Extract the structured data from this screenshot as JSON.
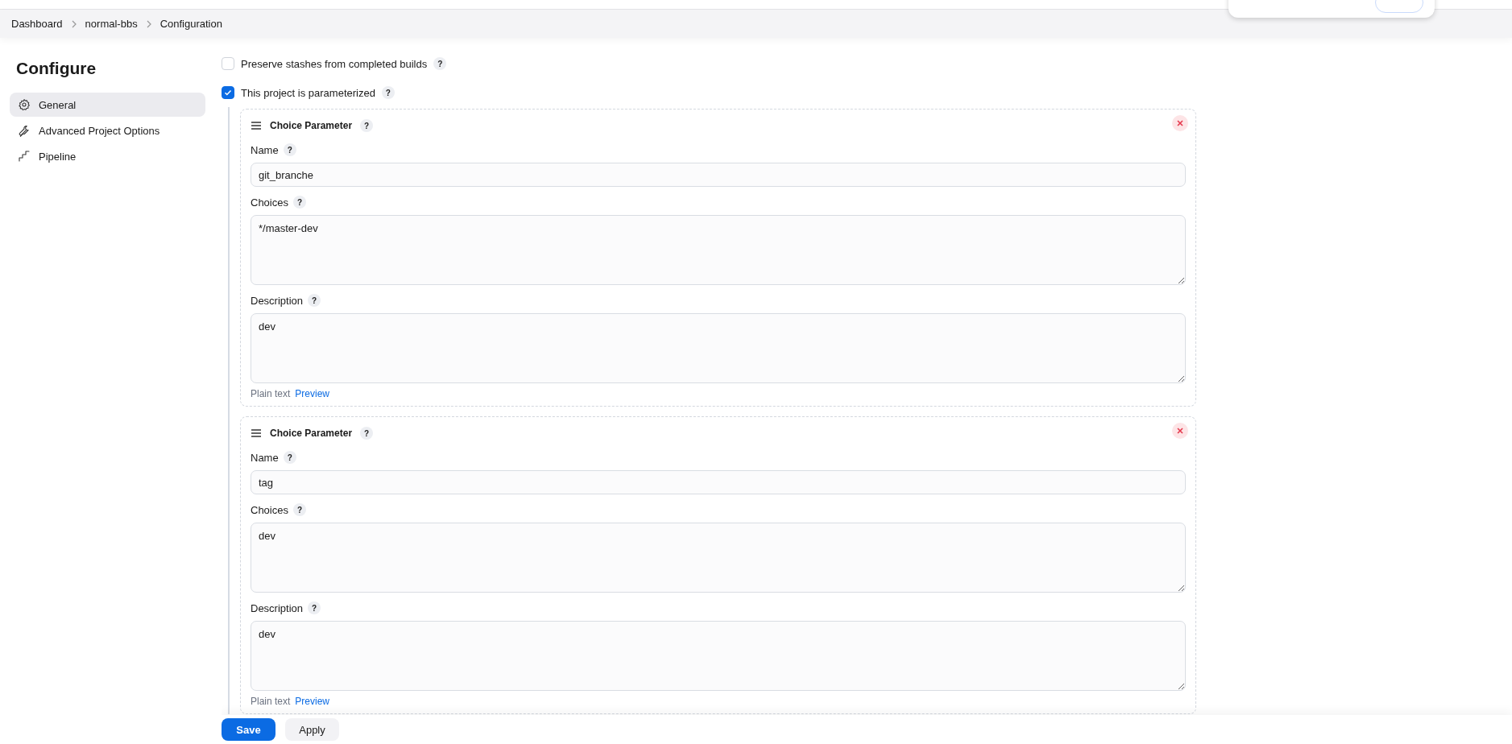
{
  "breadcrumbs": [
    "Dashboard",
    "normal-bbs",
    "Configuration"
  ],
  "sidebar": {
    "title": "Configure",
    "items": [
      {
        "label": "General",
        "kind": "gear",
        "selected": true
      },
      {
        "label": "Advanced Project Options",
        "kind": "wrench",
        "selected": false
      },
      {
        "label": "Pipeline",
        "kind": "pipeline",
        "selected": false
      }
    ]
  },
  "options": [
    {
      "label": "Preserve stashes from completed builds",
      "help": "?",
      "checked": false
    },
    {
      "label": "This project is parameterized",
      "help": "?",
      "checked": true
    }
  ],
  "parameters": [
    {
      "title": "Choice Parameter",
      "help": "?",
      "fields": [
        {
          "label": "Name",
          "help": "?",
          "kind": "input",
          "value": "git_branche"
        },
        {
          "label": "Choices",
          "help": "?",
          "kind": "textarea",
          "value": "*/master-dev"
        },
        {
          "label": "Description",
          "help": "?",
          "kind": "textarea",
          "value": "dev"
        }
      ],
      "format": [
        "Plain text",
        "Preview"
      ]
    },
    {
      "title": "Choice Parameter",
      "help": "?",
      "fields": [
        {
          "label": "Name",
          "help": "?",
          "kind": "input",
          "value": "tag"
        },
        {
          "label": "Choices",
          "help": "?",
          "kind": "textarea",
          "value": "dev"
        },
        {
          "label": "Description",
          "help": "?",
          "kind": "textarea",
          "value": "dev"
        }
      ],
      "format": [
        "Plain text",
        "Preview"
      ]
    }
  ],
  "buttons": [
    {
      "label": "Save",
      "kind": "primary"
    },
    {
      "label": "Apply",
      "kind": "secondary"
    }
  ]
}
